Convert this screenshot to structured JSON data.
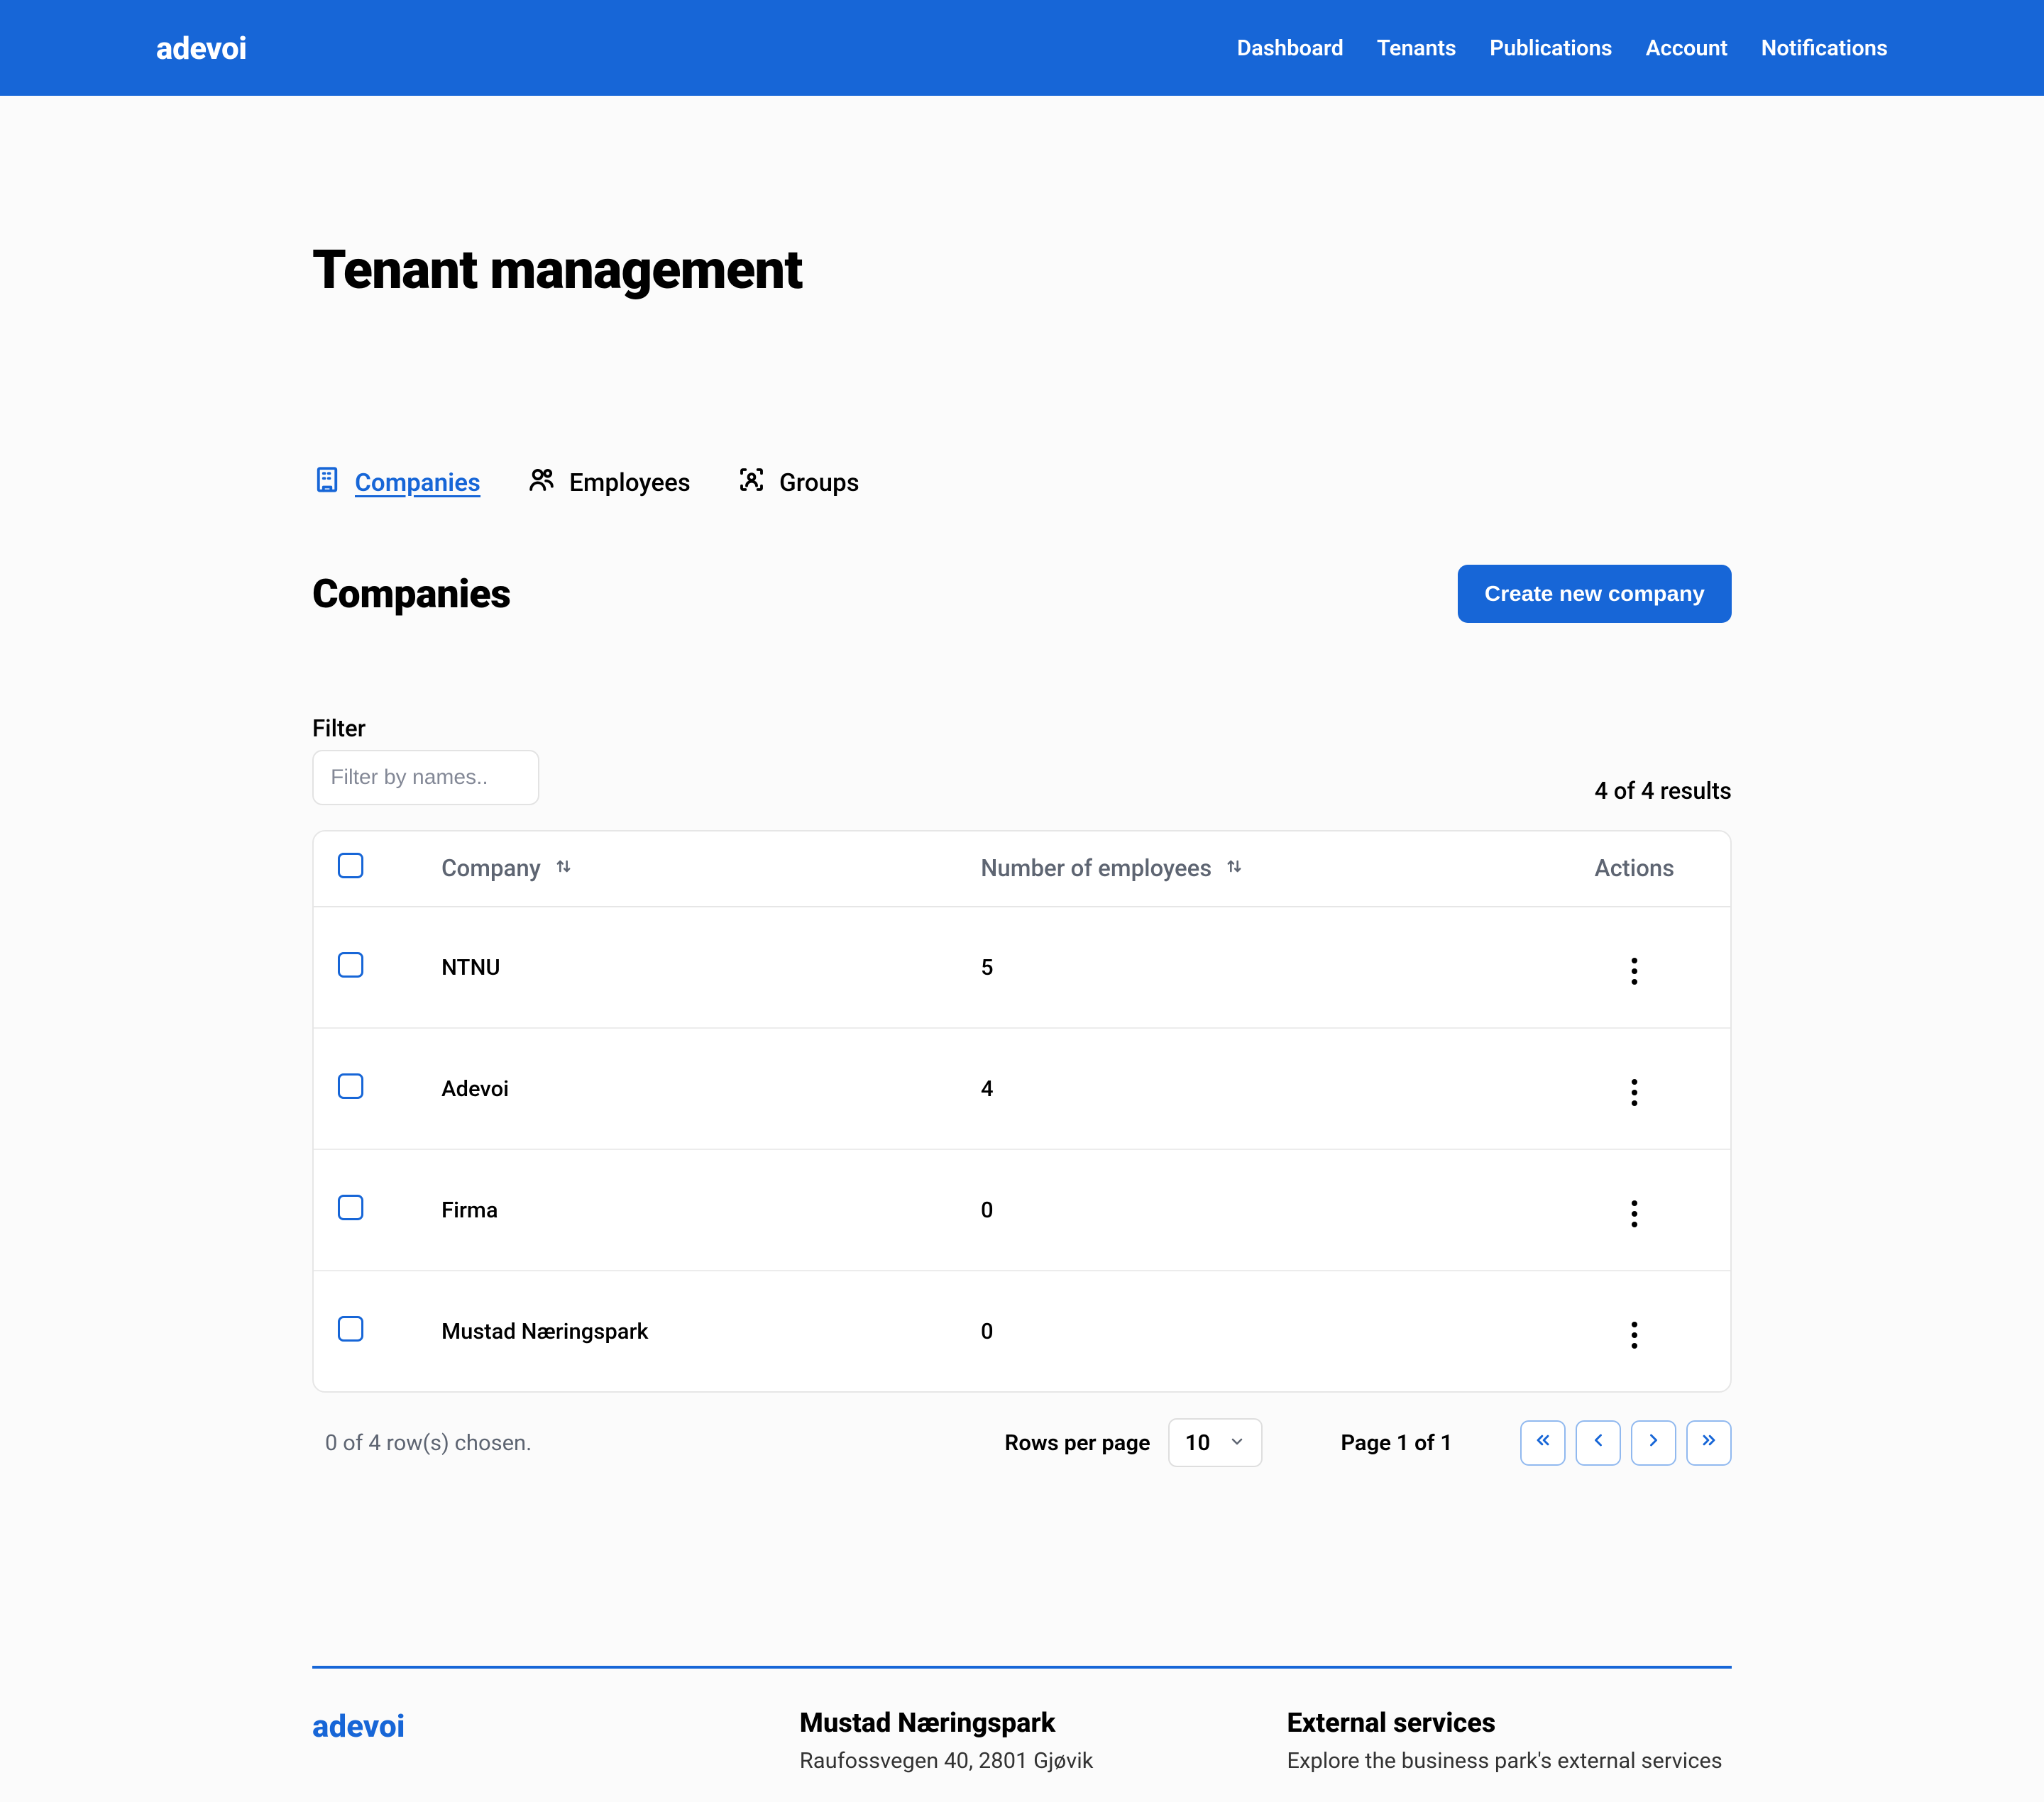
{
  "brand": "adevoi",
  "nav": {
    "dashboard": "Dashboard",
    "tenants": "Tenants",
    "publications": "Publications",
    "account": "Account",
    "notifications": "Notifications"
  },
  "page_title": "Tenant management",
  "tabs": {
    "companies": "Companies",
    "employees": "Employees",
    "groups": "Groups"
  },
  "section": {
    "title": "Companies",
    "create_btn": "Create new company"
  },
  "filter": {
    "label": "Filter",
    "placeholder": "Filter by names..",
    "results": "4 of 4 results"
  },
  "table": {
    "headers": {
      "company": "Company",
      "employees": "Number of employees",
      "actions": "Actions"
    },
    "rows": [
      {
        "company": "NTNU",
        "employees": "5"
      },
      {
        "company": "Adevoi",
        "employees": "4"
      },
      {
        "company": "Firma",
        "employees": "0"
      },
      {
        "company": "Mustad Næringspark",
        "employees": "0"
      }
    ],
    "rows_chosen": "0 of 4 row(s) chosen.",
    "rows_per_page_label": "Rows per page",
    "rows_per_page_value": "10",
    "page_info": "Page 1 of 1"
  },
  "footer": {
    "brand": "adevoi",
    "col1_heading": "Mustad Næringspark",
    "col1_sub": "Raufossvegen 40, 2801 Gjøvik",
    "col2_heading": "External services",
    "col2_sub": "Explore the business park's external services"
  }
}
